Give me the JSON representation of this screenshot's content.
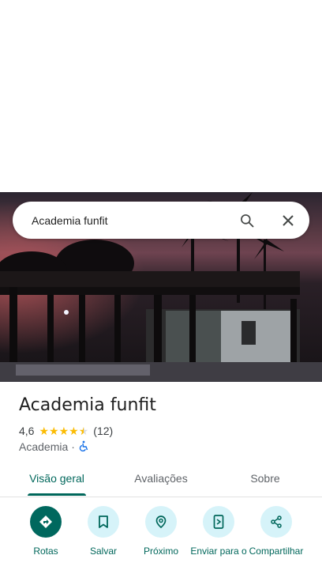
{
  "search": {
    "value": "Academia funfit"
  },
  "place": {
    "name": "Academia funfit",
    "rating": "4,6",
    "stars": 4.5,
    "reviews": "(12)",
    "category": "Academia",
    "separator": "·"
  },
  "tabs": [
    {
      "label": "Visão geral",
      "active": true
    },
    {
      "label": "Avaliações",
      "active": false
    },
    {
      "label": "Sobre",
      "active": false
    }
  ],
  "actions": [
    {
      "label": "Rotas",
      "icon": "directions-icon"
    },
    {
      "label": "Salvar",
      "icon": "bookmark-icon"
    },
    {
      "label": "Próximo",
      "icon": "nearby-icon"
    },
    {
      "label": "Enviar para o",
      "icon": "send-to-phone-icon"
    },
    {
      "label": "Compartilhar",
      "icon": "share-icon"
    }
  ],
  "colors": {
    "accent": "#00675b",
    "action_bg": "#d6f3f9",
    "primary_action_bg": "#00685e",
    "star": "#fbbc04",
    "accessibility": "#1a73e8"
  }
}
